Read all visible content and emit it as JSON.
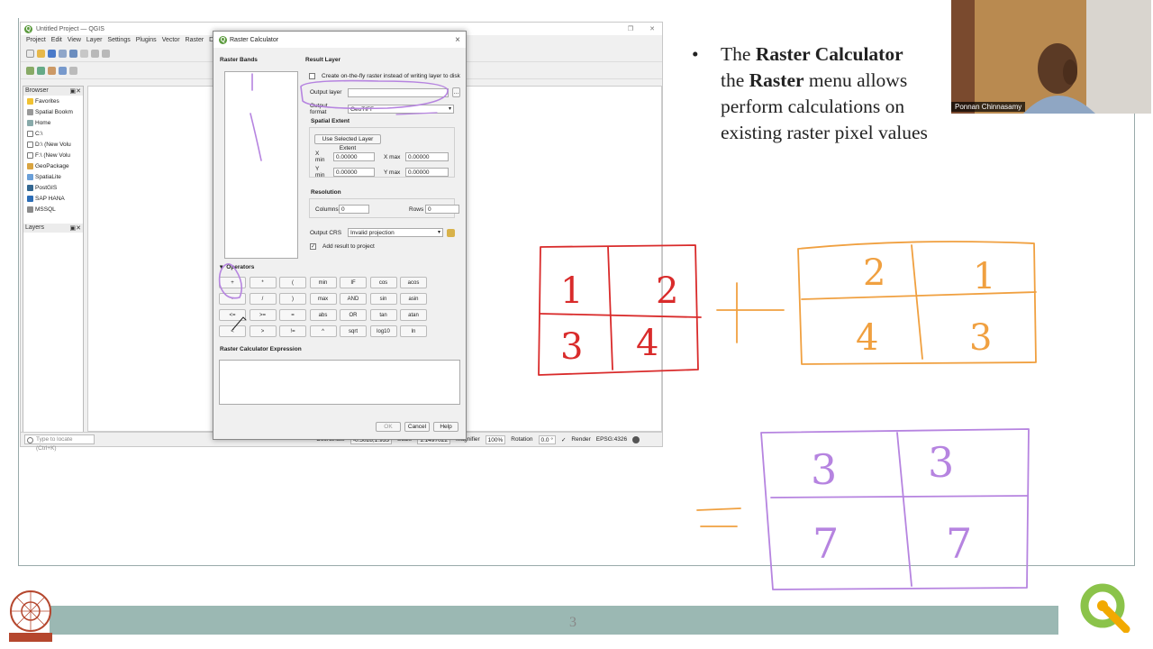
{
  "qgis": {
    "title": "Untitled Project — QGIS",
    "menu": [
      "Project",
      "Edit",
      "View",
      "Layer",
      "Settings",
      "Plugins",
      "Vector",
      "Raster",
      "Data"
    ],
    "browser_title": "Browser",
    "browser_items": [
      {
        "label": "Favorites",
        "icon": "star-icon"
      },
      {
        "label": "Spatial Bookm",
        "icon": "bookmark-icon"
      },
      {
        "label": "Home",
        "icon": "home-folder-icon"
      },
      {
        "label": "C:\\",
        "icon": "folder-icon"
      },
      {
        "label": "D:\\ (New Volu",
        "icon": "folder-icon"
      },
      {
        "label": "F:\\ (New Volu",
        "icon": "folder-icon"
      },
      {
        "label": "GeoPackage",
        "icon": "geopackage-icon"
      },
      {
        "label": "SpatiaLite",
        "icon": "spatialite-icon"
      },
      {
        "label": "PostGIS",
        "icon": "postgis-icon"
      },
      {
        "label": "SAP HANA",
        "icon": "saphana-icon"
      },
      {
        "label": "MSSQL",
        "icon": "mssql-icon"
      }
    ],
    "layers_title": "Layers",
    "locate_placeholder": "Type to locate (Ctrl+K)",
    "status": {
      "coordinate_label": "Coordinate",
      "coordinate_value": "-0.5028,1.933",
      "scale_label": "Scale",
      "scale_value": "1:1497022",
      "magnifier_label": "Magnifier",
      "magnifier_value": "100%",
      "rotation_label": "Rotation",
      "rotation_value": "0.0 °",
      "render_label": "Render",
      "crs": "EPSG:4326"
    }
  },
  "dialog": {
    "title": "Raster Calculator",
    "raster_bands_label": "Raster Bands",
    "result_layer_label": "Result Layer",
    "on_the_fly_label": "Create on-the-fly raster instead of writing layer to disk",
    "output_layer_label": "Output layer",
    "output_layer_value": "",
    "output_format_label": "Output format",
    "output_format_value": "GeoTIFF",
    "spatial_extent_label": "Spatial Extent",
    "use_extent_button": "Use Selected Layer Extent",
    "xmin_label": "X min",
    "xmin_value": "0.00000",
    "xmax_label": "X max",
    "xmax_value": "0.00000",
    "ymin_label": "Y min",
    "ymin_value": "0.00000",
    "ymax_label": "Y max",
    "ymax_value": "0.00000",
    "resolution_label": "Resolution",
    "columns_label": "Columns",
    "columns_value": "0",
    "rows_label": "Rows",
    "rows_value": "0",
    "output_crs_label": "Output CRS",
    "output_crs_value": "Invalid projection",
    "add_to_project_label": "Add result to project",
    "operators_label": "Operators",
    "operators": [
      "+",
      "*",
      "(",
      "min",
      "IF",
      "cos",
      "acos",
      "-",
      "/",
      ")",
      "max",
      "AND",
      "sin",
      "asin",
      "<=",
      "^",
      ">=",
      "=",
      "abs",
      "OR",
      "tan",
      "atan",
      "<",
      ">",
      "!=",
      "^",
      "sqrt",
      "log10",
      "ln"
    ],
    "expression_label": "Raster Calculator Expression",
    "ok": "OK",
    "cancel": "Cancel",
    "help": "Help"
  },
  "slide": {
    "bullet_dot": "•",
    "line1_pre": "The ",
    "line1_bold": "Raster Calculator",
    "line2_pre": "the ",
    "line2_bold": "Raster",
    "line2_post": " menu allows",
    "line3": "perform calculations on",
    "line4": "existing raster pixel values",
    "page_number": "3",
    "presenter_name": "Ponnan Chinnasamy",
    "colors": {
      "red": "#d92b2b",
      "orange": "#f0a040",
      "purple": "#b684e0",
      "footer": "#9bb8b3"
    }
  },
  "drawing": {
    "grid_a": [
      "1",
      "2",
      "3",
      "4"
    ],
    "plus": "+",
    "grid_b": [
      "2",
      "1",
      "4",
      "3"
    ],
    "equals": "=",
    "grid_c": [
      "3",
      "3",
      "7",
      "7"
    ]
  }
}
